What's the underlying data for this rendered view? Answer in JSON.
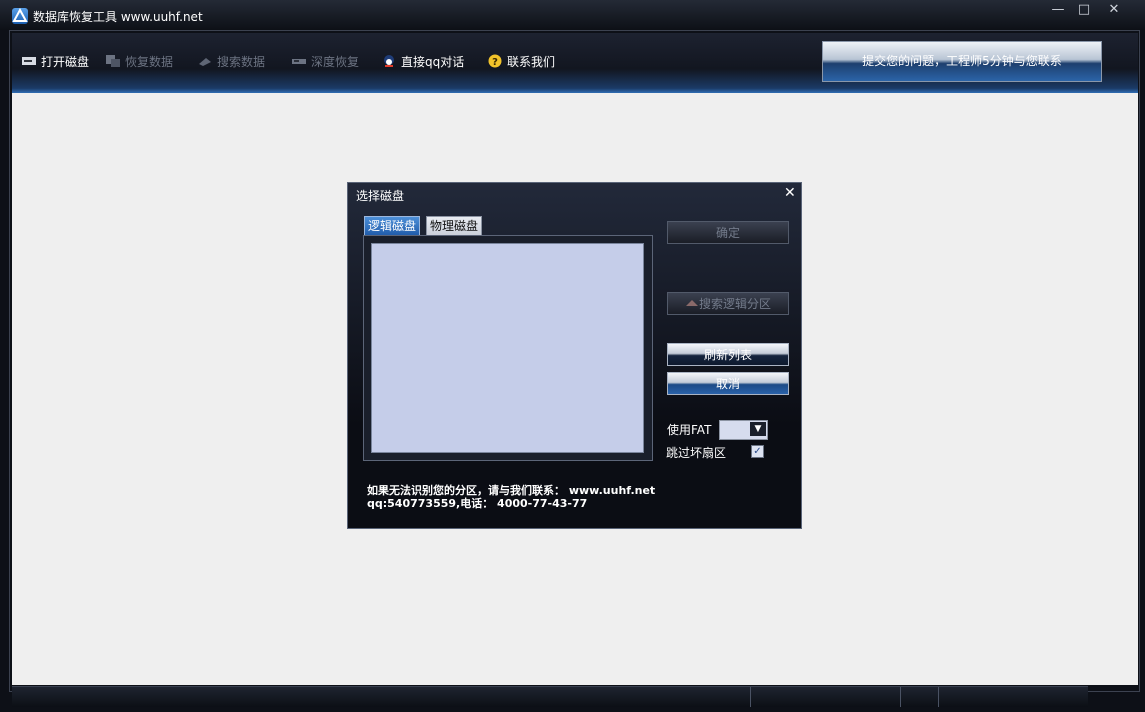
{
  "window": {
    "title": "数据库恢复工具 www.uuhf.net",
    "controls": [
      "—",
      "□",
      "✕"
    ]
  },
  "toolbar": {
    "items": [
      {
        "label": "打开磁盘",
        "icon": "disk-icon",
        "enabled": true
      },
      {
        "label": "恢复数据",
        "icon": "restore-icon",
        "enabled": false
      },
      {
        "label": "搜索数据",
        "icon": "search-data-icon",
        "enabled": false
      },
      {
        "label": "深度恢复",
        "icon": "deep-restore-icon",
        "enabled": false
      },
      {
        "label": "直接qq对话",
        "icon": "qq-icon",
        "enabled": true
      },
      {
        "label": "联系我们",
        "icon": "help-icon",
        "enabled": true
      }
    ],
    "support_button": "提交您的问题，工程师5分钟与您联系"
  },
  "dialog": {
    "title": "选择磁盘",
    "close": "✕",
    "tabs": [
      "逻辑磁盘",
      "物理磁盘"
    ],
    "active_tab": "逻辑磁盘",
    "buttons": {
      "ok": "确定",
      "search_partition": "搜索逻辑分区",
      "refresh": "刷新列表",
      "cancel": "取消"
    },
    "use_fat_label": "使用FAT",
    "use_fat_value": "",
    "skip_bad_sectors_label": "跳过坏扇区",
    "skip_bad_sectors_checked": true,
    "info_line1": "如果无法识别您的分区，请与我们联系： www.uuhf.net",
    "info_line2": "qq:540773559,电话： 4000-77-43-77"
  },
  "colors": {
    "toolbar_bg": "#121620",
    "accent_blue": "#2f6db4",
    "list_bg": "#c5cde9",
    "content_bg": "#efefef"
  }
}
